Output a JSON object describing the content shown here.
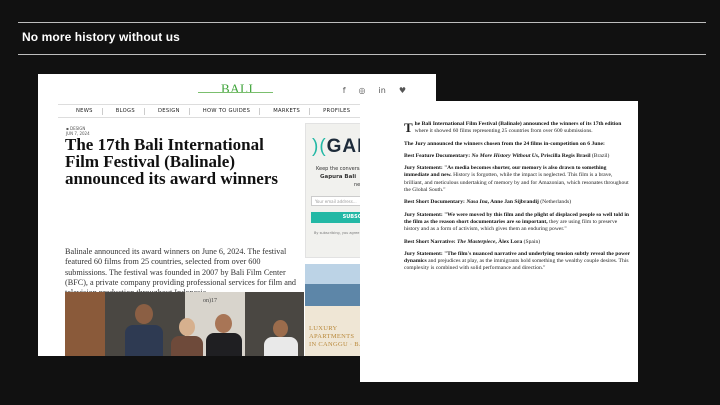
{
  "slide": {
    "title": "No more history without us"
  },
  "left_card": {
    "logo": "BALI",
    "social_icons": [
      "f",
      "◎",
      "in",
      "♥"
    ],
    "nav": [
      "NEWS",
      "BLOGS",
      "DESIGN",
      "HOW TO GUIDES",
      "MARKETS",
      "PROFILES"
    ],
    "meta_category": "▪ DESIGN",
    "meta_date": "JUN 7, 2024",
    "headline": "The 17th Bali International Film Festival (Balinale) announced its award winners",
    "body": "Balinale announced its award winners on June 6, 2024. The festival featured 60 films from 25 countries, selected from over 600 submissions. The festival was founded in 2007 by Bali Film Center (BFC), a private company providing professional services for film and television production throughout Indonesia.",
    "photo_text": "on)17",
    "ad": {
      "logo_prefix": ")(",
      "logo_text": "GAF",
      "line1": "Keep the conversa",
      "line2": "Gapura Bali",
      "line3": "newsle",
      "input_placeholder": "Your email address...",
      "button": "SUBSC",
      "small": "By subscribing, you agree to Terms and co"
    },
    "ad2": {
      "title_line1": "LUXURY",
      "title_line2": "APARTMENTS",
      "title_line3": "IN CANGGU · BAL"
    }
  },
  "right_card": {
    "p1_dropcap": "T",
    "p1_bold": "he Bali International Film Festival (Balinale) announced the winners of its 17th edition",
    "p1_rest": " where it showed 60 films representing 25 countries from over 600 submissions.",
    "p2": "The Jury announced the winners chosen from the 24 films in-competition on 6 June:",
    "p3_label": "Best Feature Documentary: ",
    "p3_title": "No More History Without Us",
    "p3_credit": ", Priscilla Regis Brasil",
    "p3_country": " (Brazil)",
    "p4_bold": "Jury Statement: \"As media becomes shorter, our memory is also drawn to something immediate and new.",
    "p4_rest": " History is forgotten, while the impact is neglected. This film is a brave, brilliant, and meticulous undertaking of memory by and for Amazonian, which resonates throughout the Global South.\"",
    "p5_label": "Best Short Documentary: ",
    "p5_title": "Nasa Ina",
    "p5_credit": ", Anne Jan Sijbrandij",
    "p5_country": " (Netherlands)",
    "p6_bold": "Jury Statement: \"We were moved by this film and the plight of displaced people so well told in the film as the reason short documentaries are so important,",
    "p6_rest": " they are using film to preserve history and as a form of activism, which gives them an enduring power.\"",
    "p7_label": "Best Short Narrative: ",
    "p7_title": "The Masterpiece",
    "p7_credit": ", Àlex Lora",
    "p7_country": " (Spain)",
    "p8_bold": "Jury Statement: \"The film's nuanced narrative and underlying tension subtly reveal the power dynamics",
    "p8_rest": " and prejudices at play, as the immigrants hold something the wealthy couple desires. This complexity is combined with solid performance and direction.\""
  }
}
